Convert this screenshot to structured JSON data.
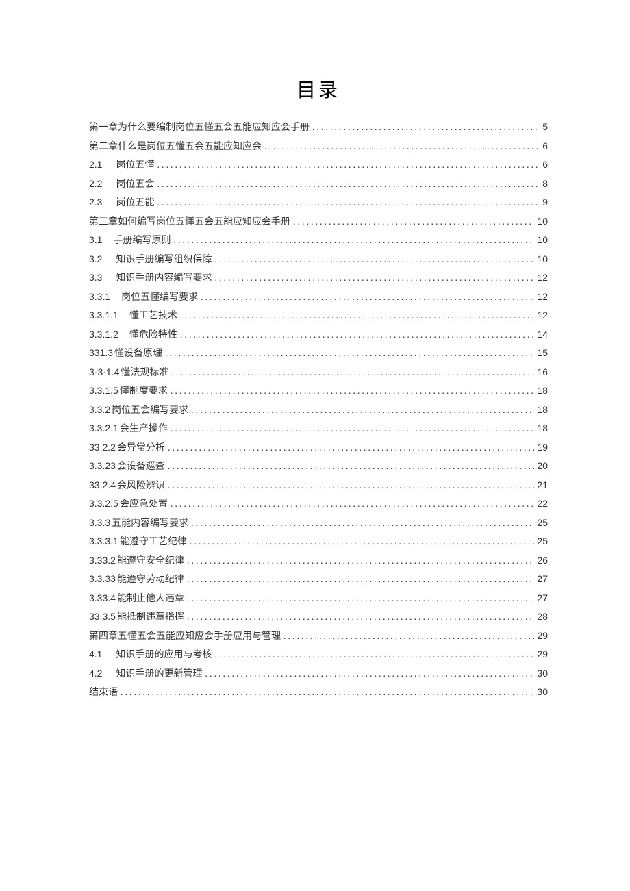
{
  "title": "目录",
  "entries": [
    {
      "num": "",
      "gap": 0,
      "text": "第一章为什么要编制岗位五懂五会五能应知应会手册",
      "page": "5"
    },
    {
      "num": "",
      "gap": 0,
      "text": "第二章什么是岗位五懂五会五能应知应会",
      "page": "6"
    },
    {
      "num": "2.1",
      "gap": 20,
      "text": "岗位五懂",
      "page": "6"
    },
    {
      "num": "2.2",
      "gap": 20,
      "text": "岗位五会",
      "page": "8"
    },
    {
      "num": "2.3",
      "gap": 20,
      "text": "岗位五能",
      "page": "9"
    },
    {
      "num": "",
      "gap": 0,
      "text": "第三章如何编写岗位五懂五会五能应知应会手册",
      "page": "10"
    },
    {
      "num": "3.1",
      "gap": 16,
      "text": "手册编写原则",
      "page": "10"
    },
    {
      "num": "3.2",
      "gap": 20,
      "text": "知识手册编写组织保障",
      "page": "10"
    },
    {
      "num": "3.3",
      "gap": 20,
      "text": "知识手册内容编写要求",
      "page": "12"
    },
    {
      "num": "3.3.1",
      "gap": 16,
      "text": "岗位五懂编写要求",
      "page": "12"
    },
    {
      "num": "3.3.1.1",
      "gap": 16,
      "text": "懂工艺技术",
      "page": "12"
    },
    {
      "num": "3.3.1.2",
      "gap": 16,
      "text": "懂危险特性",
      "page": "14"
    },
    {
      "num": "331.3",
      "gap": 2,
      "text": "懂设备原理",
      "page": "15"
    },
    {
      "num": "3·3·1.4",
      "gap": 2,
      "text": "懂法规标准",
      "page": "16"
    },
    {
      "num": "3.3.1.5",
      "gap": 2,
      "text": "懂制度要求",
      "page": "18"
    },
    {
      "num": "3.3.2",
      "gap": 2,
      "text": "岗位五会编写要求",
      "page": "18"
    },
    {
      "num": "3.3.2.1",
      "gap": 2,
      "text": "会生产操作",
      "page": "18"
    },
    {
      "num": "33.2.2",
      "gap": 2,
      "text": "会异常分析",
      "page": "19"
    },
    {
      "num": "3.3.23",
      "gap": 2,
      "text": "会设备巡查",
      "page": "20"
    },
    {
      "num": "33.2.4",
      "gap": 2,
      "text": "会风险辨识",
      "page": "21"
    },
    {
      "num": "3.3.2.5",
      "gap": 2,
      "text": "会应急处置",
      "page": "22"
    },
    {
      "num": "3.3.3",
      "gap": 2,
      "text": "五能内容编写要求",
      "page": "25"
    },
    {
      "num": "3.3.3.1",
      "gap": 2,
      "text": "能遵守工艺纪律",
      "page": "25"
    },
    {
      "num": "3.33.2",
      "gap": 2,
      "text": "能遵守安全纪律",
      "page": "26"
    },
    {
      "num": "3.3.33",
      "gap": 2,
      "text": "能遵守劳动纪律",
      "page": "27"
    },
    {
      "num": "3.33.4",
      "gap": 2,
      "text": "能制止他人违章",
      "page": "27"
    },
    {
      "num": "33.3.5",
      "gap": 2,
      "text": "能抵制违章指挥",
      "page": "28"
    },
    {
      "num": "",
      "gap": 0,
      "text": "第四章五懂五会五能应知应会手册应用与管理",
      "page": "29"
    },
    {
      "num": "4.1",
      "gap": 20,
      "text": "知识手册的应用与考核",
      "page": "29"
    },
    {
      "num": "4.2",
      "gap": 20,
      "text": "知识手册的更新管理",
      "page": "30"
    },
    {
      "num": "",
      "gap": 0,
      "text": "结束语",
      "page": "30"
    }
  ]
}
